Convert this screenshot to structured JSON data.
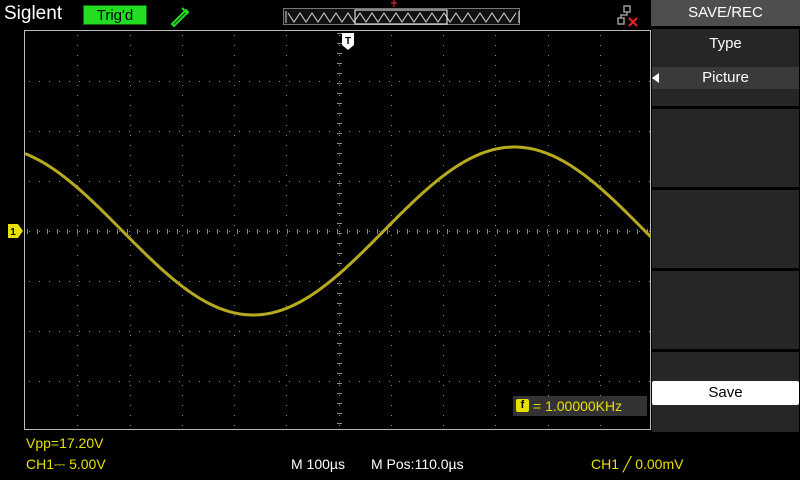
{
  "header": {
    "brand": "Siglent",
    "trigger_status": "Trig'd",
    "probe_icon": "probe-icon",
    "usb_icon": "usb-disconnected-icon"
  },
  "menu": {
    "title": "SAVE/REC",
    "type_label": "Type",
    "type_value": "Picture",
    "save_label": "Save"
  },
  "display": {
    "trigger_marker": "T",
    "channel_marker": "1",
    "frequency_badge": "f",
    "frequency_text": "= 1.00000KHz"
  },
  "status": {
    "vpp": "Vpp=17.20V",
    "ch1_scale": "CH1⎓ 5.00V",
    "timebase": "M 100µs",
    "mpos": "M Pos:110.0µs",
    "trigger": "CH1 ╱ 0.00mV"
  },
  "colors": {
    "trace": "#b8aa1e",
    "trigger_status_bg": "#22dd22",
    "channel": "#e8e000"
  }
}
